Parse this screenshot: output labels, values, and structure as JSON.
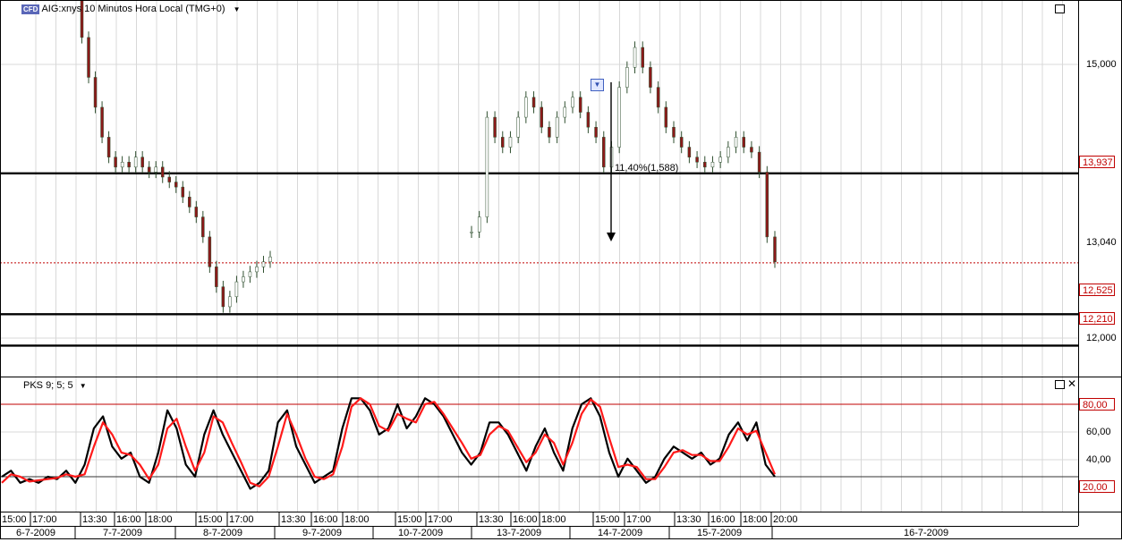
{
  "header": {
    "badge": "CFD",
    "title": "AIG:xnys 10 Minutos Hora Local (TMG+0)"
  },
  "indicator": {
    "title": "PKS 9; 5; 5"
  },
  "annotation": {
    "text": "11,40%(1,588)"
  },
  "price_axis": {
    "ticks": [
      "15,000",
      "13,040",
      "12,000"
    ],
    "tagged_levels": [
      "13,937",
      "12,525",
      "12,210"
    ],
    "current_price": "13,040"
  },
  "osc_axis": {
    "ticks": [
      "60,00",
      "40,00"
    ],
    "tagged_levels": [
      "80,00",
      "20,00"
    ]
  },
  "time_axis": {
    "times": [
      "15:00",
      "17:00",
      "13:30",
      "16:00",
      "18:00",
      "15:00",
      "17:00",
      "13:30",
      "16:00",
      "18:00",
      "15:00",
      "17:00",
      "13:30",
      "16:00",
      "18:00",
      "15:00",
      "17:00",
      "13:30",
      "16:00",
      "18:00",
      "20:00"
    ],
    "dates": [
      "6-7-2009",
      "7-7-2009",
      "8-7-2009",
      "9-7-2009",
      "10-7-2009",
      "13-7-2009",
      "14-7-2009",
      "15-7-2009",
      "16-7-2009"
    ]
  },
  "colors": {
    "up": "#ffffff",
    "down": "#8b1a1a",
    "wick": "#2f4f2f",
    "signal": "#ff1a1a",
    "main": "#000000",
    "tag": "#c00000"
  },
  "chart_data": [
    {
      "type": "line",
      "note_axis": "price",
      "horizontal_levels": [
        13.937,
        12.525,
        12.21
      ],
      "current_price": 13.04,
      "ylim": [
        11.9,
        15.55
      ],
      "series": [
        {
          "values": [
            15.9,
            15.3,
            14.9,
            14.6,
            14.3,
            14.1,
            14.0,
            14.05,
            14.0,
            14.1,
            14.0,
            13.95,
            14.0,
            13.9,
            13.85,
            13.8,
            13.7,
            13.6,
            13.5,
            13.3,
            13.0,
            12.8,
            12.6,
            12.7,
            12.85,
            12.9,
            12.95,
            13.0,
            13.05,
            13.1
          ]
        },
        {
          "values": [
            13.35,
            13.5,
            14.5,
            14.3,
            14.2,
            14.3,
            14.5,
            14.7,
            14.6,
            14.4,
            14.3,
            14.5,
            14.6,
            14.7,
            14.55,
            14.4,
            14.3,
            14.0,
            14.2,
            14.8,
            15.0,
            15.2,
            15.0,
            14.8,
            14.6,
            14.4,
            14.3,
            14.2,
            14.1,
            14.05,
            14.0,
            14.05,
            14.1,
            14.2,
            14.3,
            14.2,
            14.15,
            13.95,
            13.3,
            13.05
          ]
        }
      ]
    },
    {
      "type": "line",
      "note_axis": "oscillator",
      "ylim": [
        0,
        100
      ],
      "reference_levels": [
        80,
        20
      ],
      "series": [
        {
          "values": [
            20,
            25,
            15,
            18,
            15,
            20,
            18,
            25,
            15,
            30,
            60,
            70,
            45,
            35,
            40,
            20,
            15,
            40,
            75,
            60,
            30,
            20,
            55,
            75,
            55,
            40,
            25,
            10,
            15,
            25,
            65,
            75,
            45,
            30,
            15,
            20,
            25,
            60,
            85,
            85,
            75,
            55,
            60,
            80,
            60,
            70,
            85,
            80,
            70,
            55,
            40,
            30,
            40,
            65,
            65,
            55,
            40,
            25,
            45,
            60,
            40,
            25,
            60,
            80,
            85,
            70,
            40,
            20,
            35,
            25,
            15,
            20,
            35,
            45,
            40,
            35,
            40,
            30,
            35,
            55,
            65,
            50,
            65,
            30,
            20
          ]
        },
        {
          "values": [
            15,
            22,
            20,
            16,
            17,
            18,
            19,
            22,
            20,
            22,
            45,
            65,
            55,
            40,
            38,
            30,
            18,
            30,
            60,
            68,
            45,
            25,
            40,
            70,
            65,
            48,
            32,
            15,
            12,
            20,
            45,
            72,
            55,
            35,
            20,
            18,
            22,
            45,
            78,
            85,
            80,
            62,
            58,
            72,
            68,
            65,
            80,
            82,
            72,
            60,
            48,
            35,
            38,
            55,
            62,
            58,
            45,
            32,
            40,
            55,
            48,
            30,
            48,
            72,
            84,
            78,
            52,
            28,
            30,
            28,
            18,
            18,
            28,
            40,
            42,
            38,
            38,
            33,
            33,
            45,
            60,
            55,
            58,
            40,
            22
          ]
        }
      ]
    }
  ]
}
